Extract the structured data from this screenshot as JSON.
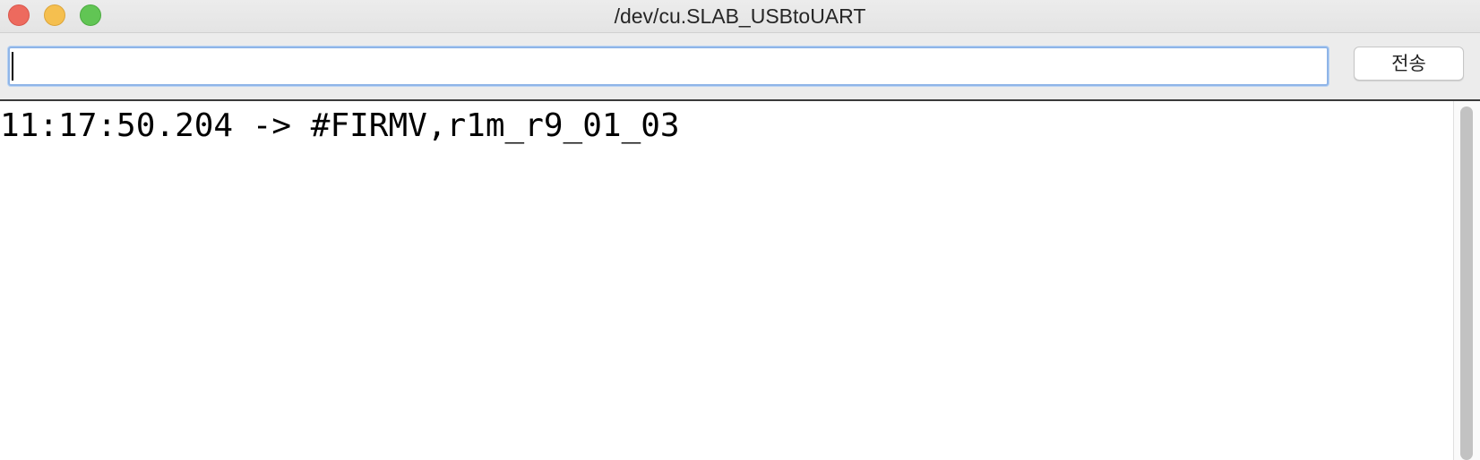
{
  "window": {
    "title": "/dev/cu.SLAB_USBtoUART"
  },
  "toolbar": {
    "input_value": "",
    "send_label": "전송"
  },
  "console": {
    "lines": [
      "11:17:50.204 -> #FIRMV,r1m_r9_01_03"
    ]
  },
  "colors": {
    "close": "#ed6a5e",
    "minimize": "#f5bf4f",
    "zoom": "#61c554",
    "input_focus": "#8fb5e8"
  }
}
